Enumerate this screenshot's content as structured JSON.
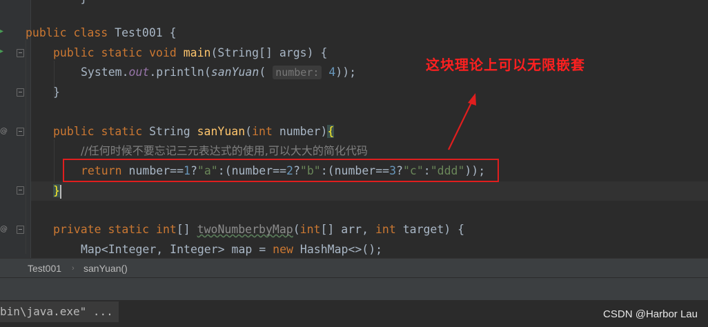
{
  "editor": {
    "line0": "        }",
    "l1_kw1": "public",
    "l1_kw2": "class",
    "l1_rest": " Test001 {",
    "l2_kw": "public static void ",
    "l2_fn": "main",
    "l2_rest": "(String[] args) {",
    "l3_a": "System.",
    "l3_out": "out",
    "l3_b": ".println(",
    "l3_call": "sanYuan",
    "l3_paren": "( ",
    "l3_hint_label": "number:",
    "l3_hint_value": " 4",
    "l3_end": "));",
    "l4": "}",
    "l5_kw": "public static ",
    "l5_type": "String ",
    "l5_fn": "sanYuan",
    "l5_p1": "(",
    "l5_int": "int",
    "l5_p2": " number)",
    "l5_brace": "{",
    "l6_comment": "//任何时候不要忘记三元表达式的使用,可以大大的简化代码",
    "l7_kw": "return",
    "l7_a": " number==",
    "l7_n1": "1",
    "l7_b": "?",
    "l7_s1": "\"a\"",
    "l7_c": ":(number==",
    "l7_n2": "2",
    "l7_d": "?",
    "l7_s2": "\"b\"",
    "l7_e": ":(number==",
    "l7_n3": "3",
    "l7_f": "?",
    "l7_s3": "\"c\"",
    "l7_g": ":",
    "l7_s4": "\"ddd\"",
    "l7_h": "));",
    "l8_brace": "}",
    "l9_kw": "private static ",
    "l9_int": "int",
    "l9_arr": "[] ",
    "l9_fn": "twoNumberbyMap",
    "l9_p1": "(",
    "l9_int2": "int",
    "l9_p2": "[] arr, ",
    "l9_int3": "int",
    "l9_p3": " target) {",
    "l10_a": "Map<Integer, Integer> map = ",
    "l10_new": "new",
    "l10_b": " HashMap<>();"
  },
  "annotation": "这块理论上可以无限嵌套",
  "breadcrumb": {
    "class": "Test001",
    "separator": "›",
    "method": "sanYuan()"
  },
  "console": {
    "text": "bin\\java.exe\" ..."
  },
  "watermark": "CSDN @Harbor Lau",
  "icons": {
    "run": "run-gutter-icon",
    "override": "override-at-icon",
    "fold": "fold-marker-icon",
    "arrow": "red-arrow"
  },
  "colors": {
    "background": "#2b2b2b",
    "keyword": "#cc7832",
    "function": "#ffc66d",
    "string": "#6a8759",
    "number": "#6897bb",
    "annotation_red": "#ff2020"
  }
}
